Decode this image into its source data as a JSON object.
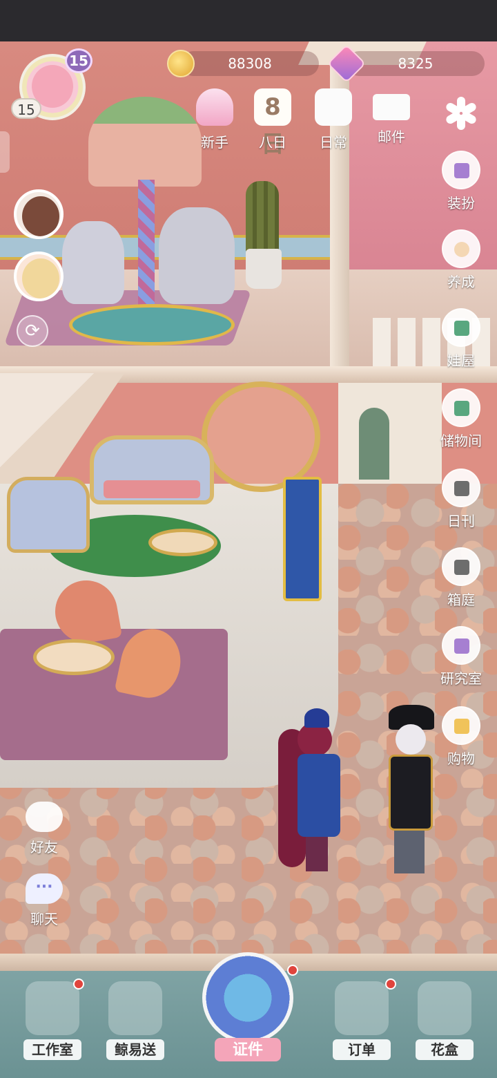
{
  "player": {
    "avatar_level": "15",
    "chip_level": "15"
  },
  "currency": {
    "coins": "88308",
    "gems": "8325"
  },
  "top_menu": [
    {
      "label": "新手",
      "icon": "gift-icon"
    },
    {
      "label": "八日",
      "icon": "eight-day-icon",
      "glyph": "8日"
    },
    {
      "label": "日常",
      "icon": "clipboard-icon"
    },
    {
      "label": "邮件",
      "icon": "mail-icon"
    }
  ],
  "right_menu": [
    {
      "label": "装扮",
      "icon": "hanger-icon"
    },
    {
      "label": "养成",
      "icon": "doll-icon"
    },
    {
      "label": "娃屋",
      "icon": "dollhouse-icon"
    },
    {
      "label": "储物间",
      "icon": "storage-icon"
    },
    {
      "label": "日刊",
      "icon": "camera-icon"
    },
    {
      "label": "箱庭",
      "icon": "box-garden-icon"
    },
    {
      "label": "研究室",
      "icon": "research-icon"
    },
    {
      "label": "购物",
      "icon": "shopping-bag-icon"
    }
  ],
  "left_menu": [
    {
      "label": "好友",
      "icon": "friends-icon"
    },
    {
      "label": "聊天",
      "icon": "chat-icon",
      "glyph": "···"
    }
  ],
  "refresh_glyph": "⟳",
  "bottom_menu": [
    {
      "label": "工作室",
      "icon": "studio-icon",
      "has_dot": true
    },
    {
      "label": "鲸易送",
      "icon": "delivery-icon",
      "has_dot": false
    },
    {
      "label": "证件",
      "icon": "certificate-icon",
      "has_dot": true
    },
    {
      "label": "订单",
      "icon": "order-icon",
      "has_dot": true
    },
    {
      "label": "花盒",
      "icon": "flower-box-icon",
      "has_dot": false
    }
  ],
  "colors": {
    "notification_dot": "#e0443d",
    "level_badge": "#8e69b8"
  }
}
